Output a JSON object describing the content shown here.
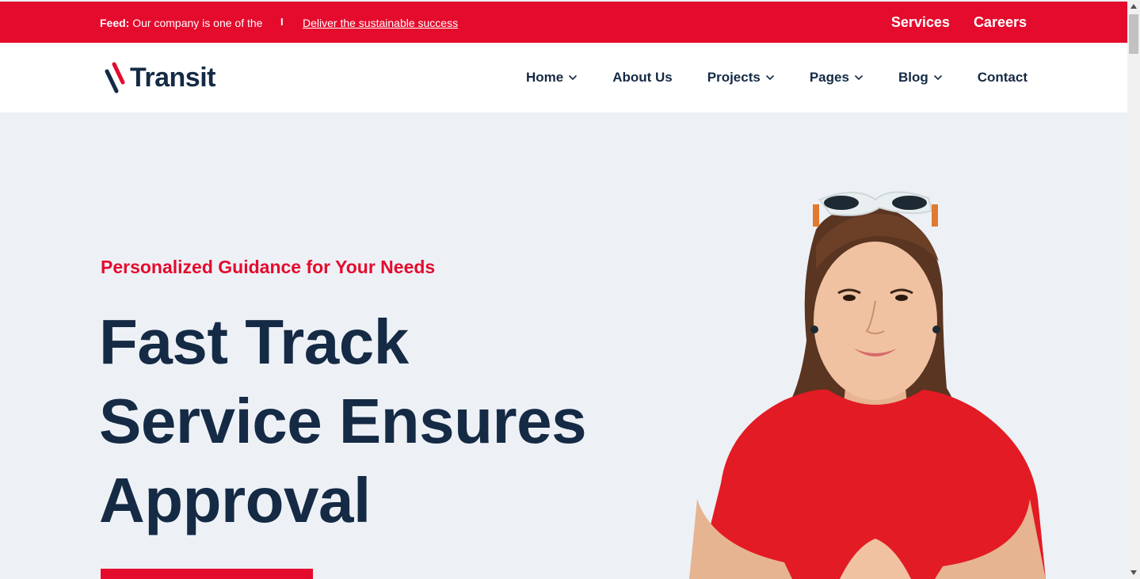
{
  "topbar": {
    "feed_label": "Feed:",
    "feed_text": "Our company is one of the",
    "separator": "I",
    "feed_link": "Deliver the sustainable success",
    "links": [
      "Services",
      "Careers"
    ]
  },
  "header": {
    "logo_text": "Transit",
    "nav": [
      {
        "label": "Home",
        "dropdown": true
      },
      {
        "label": "About Us",
        "dropdown": false
      },
      {
        "label": "Projects",
        "dropdown": true
      },
      {
        "label": "Pages",
        "dropdown": true
      },
      {
        "label": "Blog",
        "dropdown": true
      },
      {
        "label": "Contact",
        "dropdown": false
      }
    ]
  },
  "hero": {
    "eyebrow": "Personalized Guidance for Your Needs",
    "title_lines": [
      "Fast Track",
      "Service Ensures",
      "Approval"
    ]
  },
  "colors": {
    "brand_red": "#e40b2d",
    "navy": "#152a44",
    "hero_bg": "#edf1f6"
  },
  "icons": [
    "logo-mark-icon",
    "chevron-down-icon",
    "scroll-up-icon",
    "scroll-down-icon"
  ]
}
